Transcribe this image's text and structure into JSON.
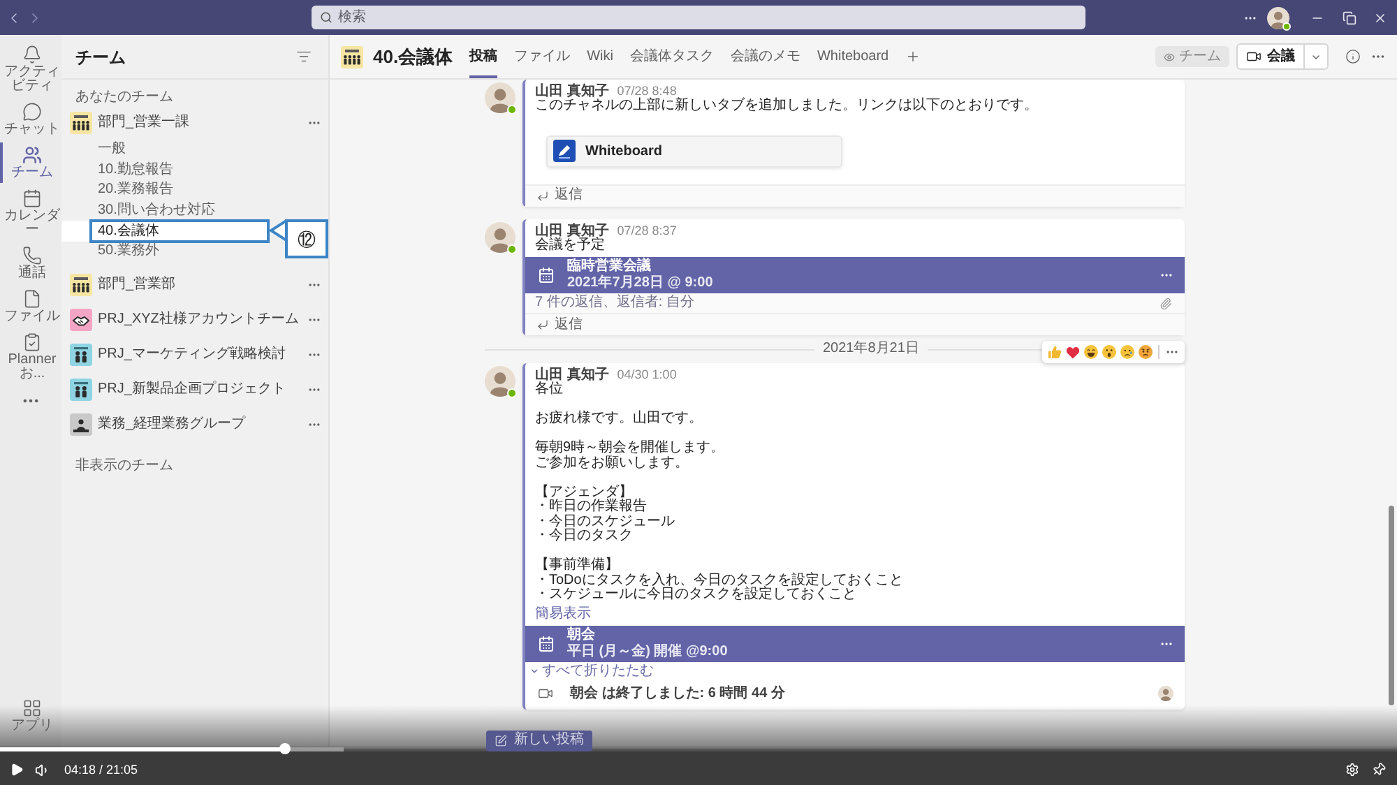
{
  "title_bar": {
    "search": {
      "placeholder": "検索"
    },
    "user": {
      "online": true
    }
  },
  "rail": {
    "items": [
      {
        "label": "アクティビティ",
        "selected": false
      },
      {
        "label": "チャット",
        "selected": false
      },
      {
        "label": "チーム",
        "selected": true
      },
      {
        "label": "カレンダー",
        "selected": false
      },
      {
        "label": "通話",
        "selected": false
      },
      {
        "label": "ファイル",
        "selected": false
      },
      {
        "label": "Planner お...",
        "selected": false
      }
    ],
    "bottom_items": [
      {
        "label": "アプリ",
        "selected": false
      }
    ]
  },
  "sidebar": {
    "title": "チーム",
    "section_label": "あなたのチーム",
    "teams": [
      {
        "name": "部門_営業一課",
        "kind": "group",
        "color": "#f6e6a2",
        "children": [
          {
            "name": "一般",
            "selected": false
          },
          {
            "name": "10.勤怠報告",
            "selected": false
          },
          {
            "name": "20.業務報告",
            "selected": false
          },
          {
            "name": "30.問い合わせ対応",
            "selected": false
          },
          {
            "name": "40.会議体",
            "selected": true,
            "annotation": "⑫"
          },
          {
            "name": "50.業務外",
            "selected": false
          }
        ]
      },
      {
        "name": "部門_営業部",
        "kind": "group",
        "color": "#f6e6a2"
      },
      {
        "name": "PRJ_XYZ社様アカウントチーム",
        "kind": "handshake",
        "color": "#f3a5c5"
      },
      {
        "name": "PRJ_マーケティング戦略検討",
        "kind": "pair",
        "color": "#8fd4e3"
      },
      {
        "name": "PRJ_新製品企画プロジェクト",
        "kind": "pair",
        "color": "#8fd4e3"
      },
      {
        "name": "業務_経理業務グループ",
        "kind": "worker",
        "color": "#c9c9c9"
      }
    ],
    "hidden_label": "非表示のチーム"
  },
  "header": {
    "team_icon": {
      "kind": "group",
      "color": "#f6e6a2"
    },
    "title": "40.会議体",
    "tabs": [
      {
        "label": "投稿",
        "selected": true
      },
      {
        "label": "ファイル",
        "selected": false
      },
      {
        "label": "Wiki",
        "selected": false
      },
      {
        "label": "会議体タスク",
        "selected": false
      },
      {
        "label": "会議のメモ",
        "selected": false
      },
      {
        "label": "Whiteboard",
        "selected": false
      }
    ],
    "team_badge": "チーム",
    "meet_button": "会議"
  },
  "posts": [
    {
      "author": "山田 真知子",
      "time": "07/28 8:48",
      "online": true,
      "hovered": false,
      "body": [
        [
          "このチャネルの上部に新しいタブを追加しました。リンクは以下のとおりです。"
        ]
      ],
      "attachment": {
        "title": "Whiteboard"
      },
      "reply": "返信"
    },
    {
      "author": "山田 真知子",
      "time": "07/28 8:37",
      "online": true,
      "hovered": false,
      "body": [
        [
          "会議を予定"
        ]
      ],
      "event": {
        "title": "臨時営業会議",
        "when": "2021年7月28日 @ 9:00"
      },
      "replies_summary": "7 件の返信、返信者: 自分",
      "reply": "返信"
    },
    {
      "date_divider": "2021年8月21日",
      "author": "山田 真知子",
      "time": "04/30 1:00",
      "online": true,
      "hovered": true,
      "body": [
        [
          "各位"
        ],
        [
          "お疲れ様です。山田です。"
        ],
        [
          "毎朝9時～朝会を開催します。",
          "ご参加をお願いします。"
        ],
        [
          "【アジェンダ】",
          "・昨日の作業報告",
          "・今日のスケジュール",
          "・今日のタスク"
        ],
        [
          "【事前準備】",
          "・ToDoにタスクを入れ、今日のタスクを設定しておくこと",
          "・スケジュールに今日のタスクを設定しておくこと"
        ]
      ],
      "show_less": "簡易表示",
      "event": {
        "title": "朝会",
        "when": "平日 (月～金) 開催 @9:00"
      },
      "collapse_all": "すべて折りたたむ",
      "meeting_ended": "朝会 は終了しました: 6 時間 44 分"
    }
  ],
  "new_post_button": "新しい投稿",
  "video_player": {
    "progress": {
      "level": 0.204
    },
    "buffered": {
      "level": 0.246
    },
    "time": "04:18 / 21:05"
  }
}
